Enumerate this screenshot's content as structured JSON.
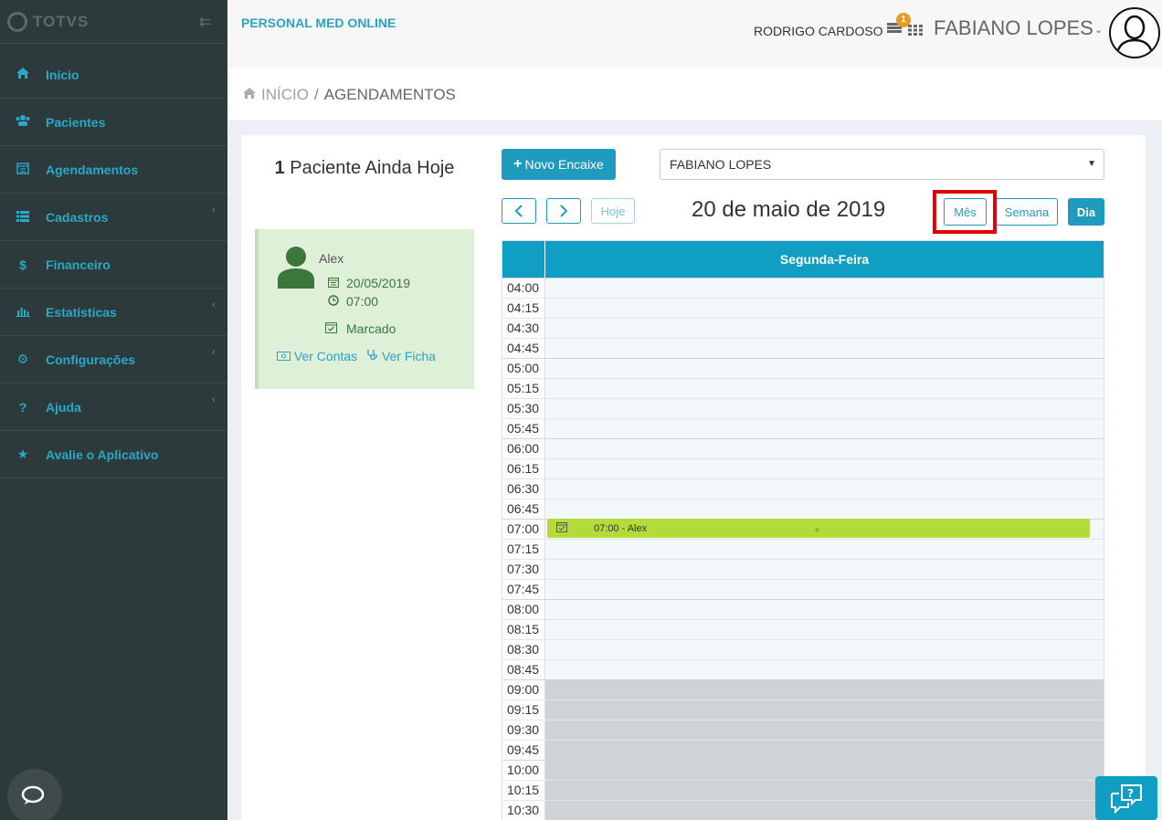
{
  "sidebar": {
    "brand": "TOTVS",
    "items": [
      {
        "label": "Início",
        "icon": "home-icon"
      },
      {
        "label": "Pacientes",
        "icon": "users-icon"
      },
      {
        "label": "Agendamentos",
        "icon": "calendar-icon"
      },
      {
        "label": "Cadastros",
        "icon": "list-icon"
      },
      {
        "label": "Financeiro",
        "icon": "dollar-icon"
      },
      {
        "label": "Estatísticas",
        "icon": "bar-chart-icon"
      },
      {
        "label": "Configurações",
        "icon": "gear-icon"
      },
      {
        "label": "Ajuda",
        "icon": "question-icon"
      },
      {
        "label": "Avalie o Aplicativo",
        "icon": "star-icon"
      }
    ]
  },
  "header": {
    "app_title": "PERSONAL MED ONLINE",
    "secondary_user": "RODRIGO CARDOSO",
    "notification_count": "1",
    "primary_user": "FABIANO LOPES"
  },
  "breadcrumb": {
    "home": "INÍCIO",
    "separator": "/",
    "current": "AGENDAMENTOS"
  },
  "pending": {
    "count": "1",
    "label": "Paciente Ainda Hoje"
  },
  "patient_card": {
    "name": "Alex",
    "date": "20/05/2019",
    "time": "07:00",
    "status": "Marcado",
    "link_accounts": "Ver Contas",
    "link_record": "Ver Ficha"
  },
  "toolbar": {
    "new_button": "Novo Encaixe",
    "doctor_selected": "FABIANO LOPES",
    "today": "Hoje",
    "date_title": "20 de maio de 2019",
    "views": [
      "Mês",
      "Semana",
      "Dia"
    ],
    "active_view": "Dia"
  },
  "calendar": {
    "day_header": "Segunda-Feira",
    "slots": [
      "04:00",
      "04:15",
      "04:30",
      "04:45",
      "05:00",
      "05:15",
      "05:30",
      "05:45",
      "06:00",
      "06:15",
      "06:30",
      "06:45",
      "07:00",
      "07:15",
      "07:30",
      "07:45",
      "08:00",
      "08:15",
      "08:30",
      "08:45",
      "09:00",
      "09:15",
      "09:30",
      "09:45",
      "10:00",
      "10:15",
      "10:30"
    ],
    "off_hours_from": "09:00",
    "event": {
      "text": "07:00 - Alex",
      "resize": "="
    }
  },
  "colors": {
    "accent": "#1f9bbf",
    "sidebar_bg": "#2c3a3b",
    "event": "#b5da3c",
    "highlight": "#e0000a"
  }
}
